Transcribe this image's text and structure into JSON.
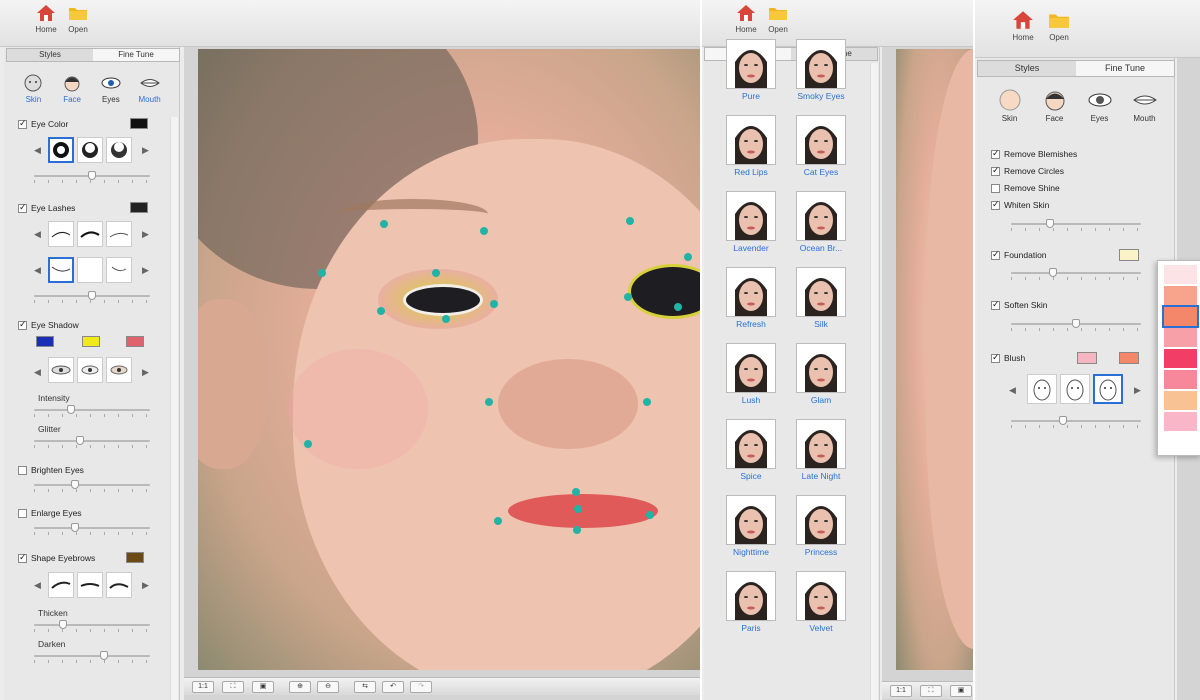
{
  "toolbar": {
    "home": "Home",
    "open": "Open"
  },
  "tabs": {
    "styles": "Styles",
    "fine_tune": "Fine Tune"
  },
  "categories": [
    "Skin",
    "Face",
    "Eyes",
    "Mouth"
  ],
  "eyes_panel": {
    "eye_color": "Eye Color",
    "eye_lashes": "Eye Lashes",
    "eye_shadow": "Eye Shadow",
    "intensity": "Intensity",
    "glitter": "Glitter",
    "brighten_eyes": "Brighten Eyes",
    "enlarge_eyes": "Enlarge Eyes",
    "shape_eyebrows": "Shape Eyebrows",
    "thicken": "Thicken",
    "darken": "Darken"
  },
  "styles": [
    "Pure",
    "Smoky Eyes",
    "Red Lips",
    "Cat Eyes",
    "Lavender",
    "Ocean Br...",
    "Refresh",
    "Silk",
    "Lush",
    "Glam",
    "Spice",
    "Late Night",
    "Nighttime",
    "Princess",
    "Paris",
    "Velvet"
  ],
  "skin_panel": {
    "remove_blemishes": "Remove Blemishes",
    "remove_circles": "Remove Circles",
    "remove_shine": "Remove Shine",
    "whiten_skin": "Whiten Skin",
    "foundation": "Foundation",
    "soften_skin": "Soften Skin",
    "blush": "Blush"
  },
  "bottom": {
    "one_to_one": "1:1"
  },
  "colors": {
    "accent": "#2a6fd6",
    "landmark": "#22b3a6",
    "blush_palette": [
      "#fbe3e6",
      "#f8a48c",
      "#f4876a",
      "#f7a0a7",
      "#f23e67",
      "#f7879b",
      "#f9c294",
      "#f8b6c8"
    ]
  }
}
